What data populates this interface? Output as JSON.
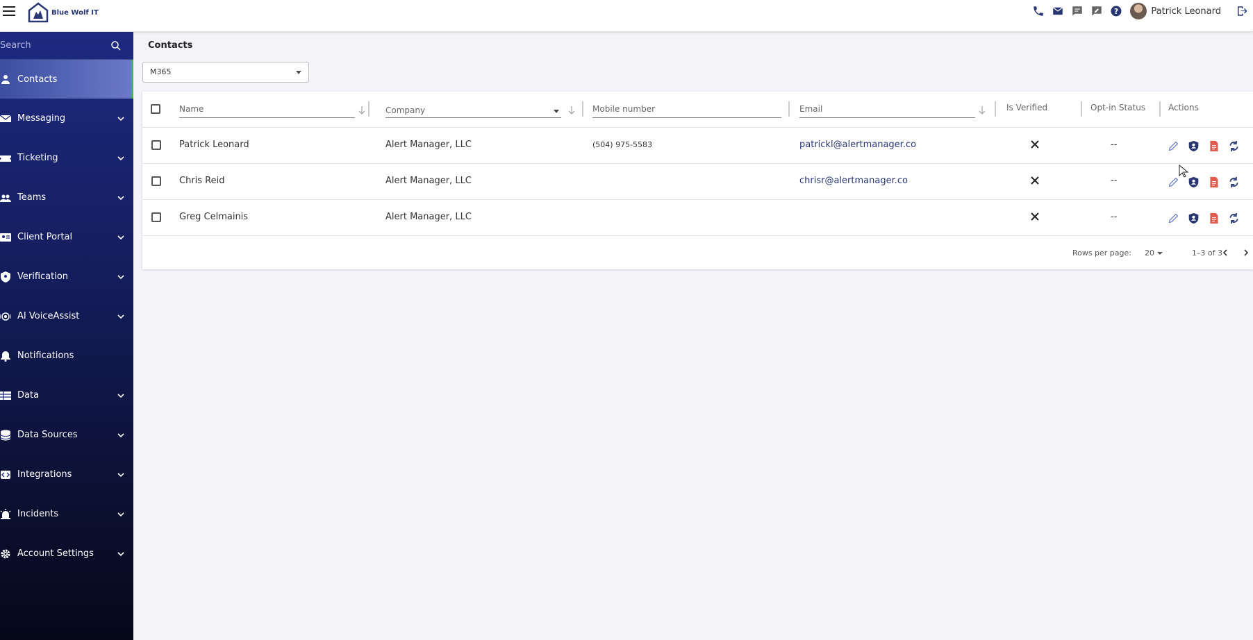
{
  "app": {
    "logo_text": "Blue Wolf IT"
  },
  "topbar": {
    "icons": [
      "phone-icon",
      "email-icon",
      "chat-icon",
      "feedback-icon",
      "help-icon"
    ],
    "user_name": "Patrick Leonard"
  },
  "sidebar": {
    "search_placeholder": "Search",
    "items": [
      {
        "label": "Contacts",
        "icon": "contact-icon",
        "active": true,
        "expandable": false
      },
      {
        "label": "Messaging",
        "icon": "mail-icon",
        "expandable": true
      },
      {
        "label": "Ticketing",
        "icon": "ticket-icon",
        "expandable": true
      },
      {
        "label": "Teams",
        "icon": "teams-icon",
        "expandable": true
      },
      {
        "label": "Client Portal",
        "icon": "portal-icon",
        "expandable": true
      },
      {
        "label": "Verification",
        "icon": "shield-icon",
        "expandable": true
      },
      {
        "label": "AI VoiceAssist",
        "icon": "voice-icon",
        "expandable": true
      },
      {
        "label": "Notifications",
        "icon": "bell-icon",
        "expandable": false
      },
      {
        "label": "Data",
        "icon": "table-icon",
        "expandable": true
      },
      {
        "label": "Data Sources",
        "icon": "database-icon",
        "expandable": true
      },
      {
        "label": "Integrations",
        "icon": "integration-icon",
        "expandable": true
      },
      {
        "label": "Incidents",
        "icon": "siren-icon",
        "expandable": true
      },
      {
        "label": "Account Settings",
        "icon": "gear-icon",
        "expandable": true
      }
    ]
  },
  "main": {
    "title": "Contacts",
    "filter_value": "M365",
    "columns": {
      "name": "Name",
      "company": "Company",
      "mobile": "Mobile number",
      "email": "Email",
      "verified": "Is Verified",
      "opt_in": "Opt-in Status",
      "actions": "Actions"
    },
    "rows": [
      {
        "name": "Patrick Leonard",
        "company": "Alert Manager, LLC",
        "mobile": "(504) 975-5583",
        "email": "patrickl@alertmanager.co",
        "opt_in": "--"
      },
      {
        "name": "Chris Reid",
        "company": "Alert Manager, LLC",
        "mobile": "",
        "email": "chrisr@alertmanager.co",
        "opt_in": "--"
      },
      {
        "name": "Greg Celmainis",
        "company": "Alert Manager, LLC",
        "mobile": "",
        "email": "",
        "opt_in": "--"
      }
    ],
    "pagination": {
      "rows_per_page_label": "Rows per page:",
      "rows_per_page": "20",
      "range": "1–3 of 3"
    }
  },
  "colors": {
    "brand": "#283772",
    "active_accent": "#3fb54a",
    "danger": "#e05a4f"
  }
}
